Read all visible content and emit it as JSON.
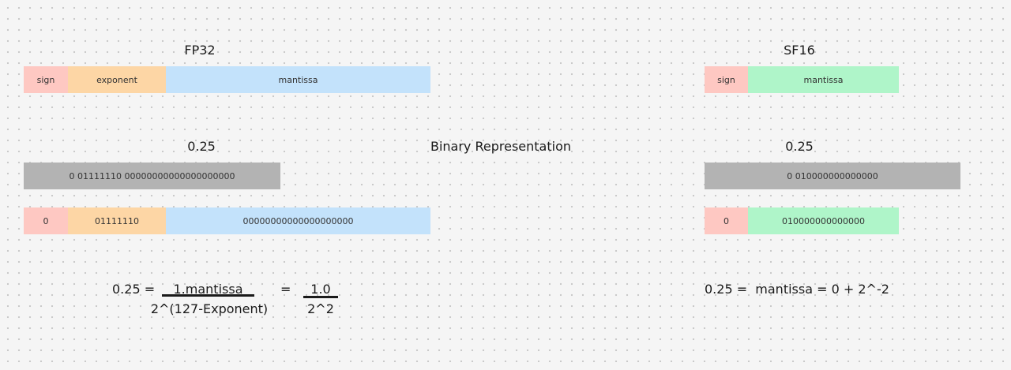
{
  "fp32": {
    "title": "FP32",
    "format": {
      "sign": "sign",
      "exponent": "exponent",
      "mantissa": "mantissa"
    },
    "value_title": "0.25",
    "binary": "0 01111110 00000000000000000000",
    "fields": {
      "sign": "0",
      "exponent": "01111110",
      "mantissa": "00000000000000000000"
    },
    "formula": {
      "lhs": "0.25 =",
      "numerator": "1.mantissa",
      "denominator": "2^(127-Exponent)",
      "equals": "=",
      "num2": "1.0",
      "den2": "2^2"
    }
  },
  "center_label": "Binary Representation",
  "sf16": {
    "title": "SF16",
    "format": {
      "sign": "sign",
      "mantissa": "mantissa"
    },
    "value_title": "0.25",
    "binary": "0 010000000000000",
    "fields": {
      "sign": "0",
      "mantissa": "010000000000000"
    },
    "formula": "0.25 =  mantissa = 0 + 2^-2"
  },
  "colors": {
    "sign": "#fec8c2",
    "exponent": "#fdd6a5",
    "mantissa_fp32": "#c3e2fb",
    "mantissa_sf16": "#aff5c9",
    "binary_bar": "#b3b3b3"
  }
}
